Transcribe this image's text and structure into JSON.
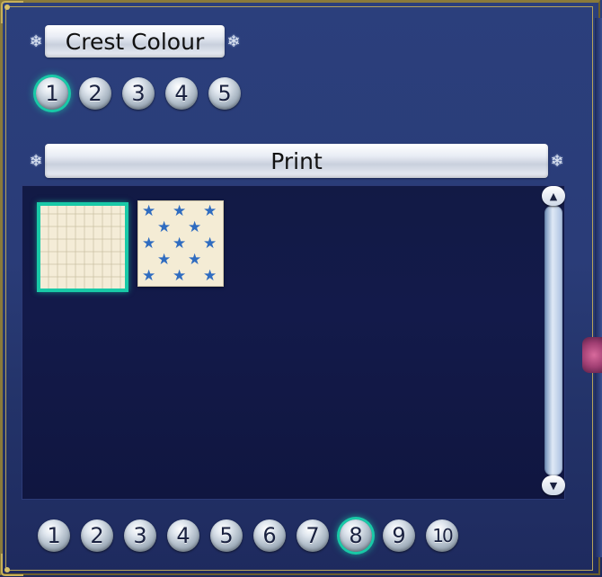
{
  "crest_colour": {
    "title": "Crest Colour",
    "options": [
      "1",
      "2",
      "3",
      "4",
      "5"
    ],
    "selected": "1"
  },
  "print": {
    "title": "Print",
    "swatches": [
      {
        "name": "cream-texture",
        "selected": true
      },
      {
        "name": "blue-stars",
        "selected": false
      }
    ]
  },
  "pages": {
    "options": [
      "1",
      "2",
      "3",
      "4",
      "5",
      "6",
      "7",
      "8",
      "9",
      "10"
    ],
    "selected": "8"
  },
  "scrollbar": {
    "up_icon": "scroll-up-arrow-icon",
    "down_icon": "scroll-down-arrow-icon"
  },
  "colors": {
    "selection": "#19c9a7",
    "star": "#2f6cc0",
    "panel": "#121a45"
  }
}
